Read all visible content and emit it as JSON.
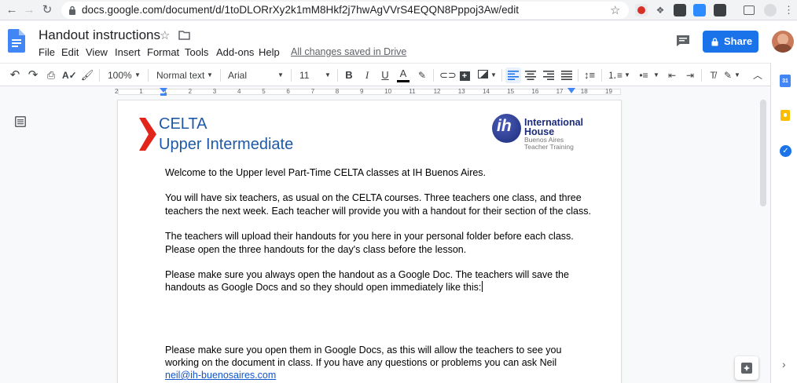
{
  "browser": {
    "url": "docs.google.com/document/d/1toDLORrXy2k1mM8Hkf2j7hwAgVVrS4EQQN8Pppoj3Aw/edit"
  },
  "docs": {
    "title": "Handout instructions",
    "menus": [
      "File",
      "Edit",
      "View",
      "Insert",
      "Format",
      "Tools",
      "Add-ons",
      "Help"
    ],
    "saved_status": "All changes saved in Drive",
    "share_label": "Share"
  },
  "toolbar": {
    "zoom": "100%",
    "style": "Normal text",
    "font": "Arial",
    "font_size": "11"
  },
  "ruler": {
    "marks": [
      "2",
      "1",
      "1",
      "2",
      "3",
      "4",
      "5",
      "6",
      "7",
      "8",
      "9",
      "10",
      "11",
      "12",
      "13",
      "14",
      "15",
      "16",
      "17",
      "18",
      "19"
    ]
  },
  "document": {
    "celta_title": "CELTA",
    "celta_subtitle": "Upper Intermediate",
    "logo_line1": "International",
    "logo_line2": "House",
    "logo_line3": "Buenos Aires",
    "logo_line4": "Teacher Training",
    "logo_mark": "ih",
    "paragraphs": [
      "Welcome to the Upper level Part-Time CELTA classes at IH Buenos Aires.",
      "You will have six teachers, as usual on the CELTA courses.  Three teachers one class, and three",
      "teachers the next week.  Each teacher will provide you with a handout for their section of the class.",
      "The teachers will upload their handouts for you here in your personal folder before each class.",
      "Please open the three handouts for the day's class before the lesson.",
      "Please make sure you always open the handout as a Google Doc.  The teachers will save the",
      "handouts as Google Docs and so they should open immediately like this:",
      "Please make sure you open them in Google Docs, as this will allow the teachers to see you",
      "working on the document in class.  If you have any questions or problems you can ask Neil"
    ],
    "email_link": "neil@ih-buenosaires.com"
  },
  "colors": {
    "accent_blue": "#1a73e8",
    "celta_blue": "#1f5aa6",
    "celta_red": "#e1251b",
    "ih_navy": "#1c2c7a",
    "link_blue": "#1155cc"
  }
}
